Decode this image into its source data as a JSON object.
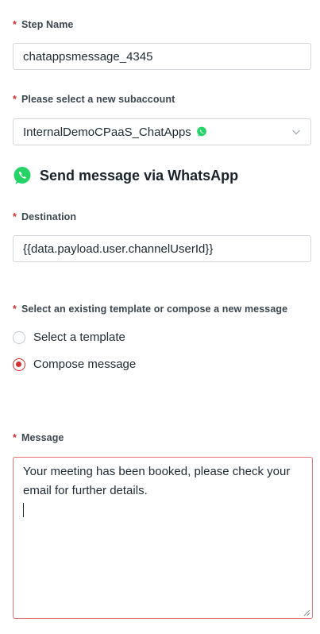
{
  "step_name": {
    "label": "Step Name",
    "value": "chatappsmessage_4345"
  },
  "subaccount": {
    "label": "Please select a new subaccount",
    "value": "InternalDemoCPaaS_ChatApps"
  },
  "section": {
    "title": "Send message via WhatsApp"
  },
  "destination": {
    "label": "Destination",
    "value": "{{data.payload.user.channelUserId}}"
  },
  "template_choice": {
    "label": "Select an existing template or compose a new message",
    "options": [
      {
        "label": "Select a template",
        "selected": false
      },
      {
        "label": "Compose message",
        "selected": true
      }
    ]
  },
  "message": {
    "label": "Message",
    "value": "Your meeting has been booked, please check your email for further details."
  },
  "required_marker": "*",
  "colors": {
    "accent": "#d32f2f",
    "whatsapp": "#25d366"
  },
  "icons": [
    "whatsapp-icon",
    "chevron-down-icon"
  ]
}
